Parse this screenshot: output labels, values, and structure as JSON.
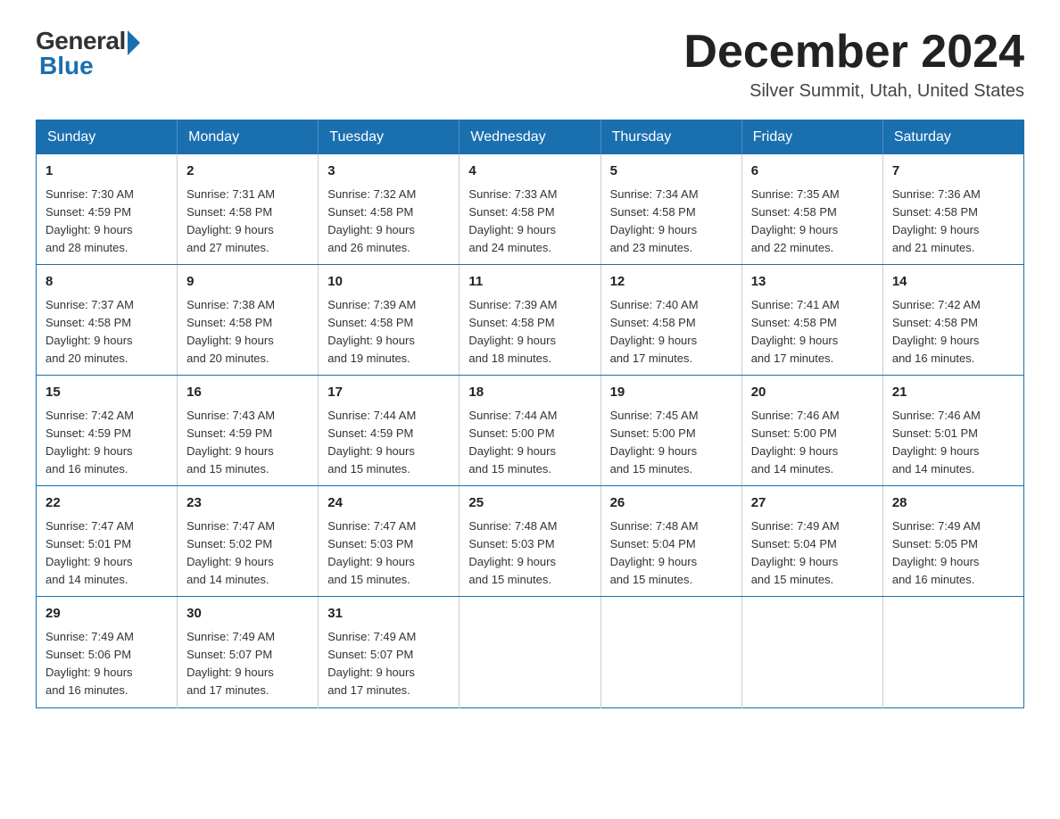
{
  "logo": {
    "general": "General",
    "blue": "Blue"
  },
  "title": {
    "month_year": "December 2024",
    "location": "Silver Summit, Utah, United States"
  },
  "days_of_week": [
    "Sunday",
    "Monday",
    "Tuesday",
    "Wednesday",
    "Thursday",
    "Friday",
    "Saturday"
  ],
  "weeks": [
    [
      {
        "day": "1",
        "sunrise": "7:30 AM",
        "sunset": "4:59 PM",
        "daylight": "9 hours and 28 minutes."
      },
      {
        "day": "2",
        "sunrise": "7:31 AM",
        "sunset": "4:58 PM",
        "daylight": "9 hours and 27 minutes."
      },
      {
        "day": "3",
        "sunrise": "7:32 AM",
        "sunset": "4:58 PM",
        "daylight": "9 hours and 26 minutes."
      },
      {
        "day": "4",
        "sunrise": "7:33 AM",
        "sunset": "4:58 PM",
        "daylight": "9 hours and 24 minutes."
      },
      {
        "day": "5",
        "sunrise": "7:34 AM",
        "sunset": "4:58 PM",
        "daylight": "9 hours and 23 minutes."
      },
      {
        "day": "6",
        "sunrise": "7:35 AM",
        "sunset": "4:58 PM",
        "daylight": "9 hours and 22 minutes."
      },
      {
        "day": "7",
        "sunrise": "7:36 AM",
        "sunset": "4:58 PM",
        "daylight": "9 hours and 21 minutes."
      }
    ],
    [
      {
        "day": "8",
        "sunrise": "7:37 AM",
        "sunset": "4:58 PM",
        "daylight": "9 hours and 20 minutes."
      },
      {
        "day": "9",
        "sunrise": "7:38 AM",
        "sunset": "4:58 PM",
        "daylight": "9 hours and 20 minutes."
      },
      {
        "day": "10",
        "sunrise": "7:39 AM",
        "sunset": "4:58 PM",
        "daylight": "9 hours and 19 minutes."
      },
      {
        "day": "11",
        "sunrise": "7:39 AM",
        "sunset": "4:58 PM",
        "daylight": "9 hours and 18 minutes."
      },
      {
        "day": "12",
        "sunrise": "7:40 AM",
        "sunset": "4:58 PM",
        "daylight": "9 hours and 17 minutes."
      },
      {
        "day": "13",
        "sunrise": "7:41 AM",
        "sunset": "4:58 PM",
        "daylight": "9 hours and 17 minutes."
      },
      {
        "day": "14",
        "sunrise": "7:42 AM",
        "sunset": "4:58 PM",
        "daylight": "9 hours and 16 minutes."
      }
    ],
    [
      {
        "day": "15",
        "sunrise": "7:42 AM",
        "sunset": "4:59 PM",
        "daylight": "9 hours and 16 minutes."
      },
      {
        "day": "16",
        "sunrise": "7:43 AM",
        "sunset": "4:59 PM",
        "daylight": "9 hours and 15 minutes."
      },
      {
        "day": "17",
        "sunrise": "7:44 AM",
        "sunset": "4:59 PM",
        "daylight": "9 hours and 15 minutes."
      },
      {
        "day": "18",
        "sunrise": "7:44 AM",
        "sunset": "5:00 PM",
        "daylight": "9 hours and 15 minutes."
      },
      {
        "day": "19",
        "sunrise": "7:45 AM",
        "sunset": "5:00 PM",
        "daylight": "9 hours and 15 minutes."
      },
      {
        "day": "20",
        "sunrise": "7:46 AM",
        "sunset": "5:00 PM",
        "daylight": "9 hours and 14 minutes."
      },
      {
        "day": "21",
        "sunrise": "7:46 AM",
        "sunset": "5:01 PM",
        "daylight": "9 hours and 14 minutes."
      }
    ],
    [
      {
        "day": "22",
        "sunrise": "7:47 AM",
        "sunset": "5:01 PM",
        "daylight": "9 hours and 14 minutes."
      },
      {
        "day": "23",
        "sunrise": "7:47 AM",
        "sunset": "5:02 PM",
        "daylight": "9 hours and 14 minutes."
      },
      {
        "day": "24",
        "sunrise": "7:47 AM",
        "sunset": "5:03 PM",
        "daylight": "9 hours and 15 minutes."
      },
      {
        "day": "25",
        "sunrise": "7:48 AM",
        "sunset": "5:03 PM",
        "daylight": "9 hours and 15 minutes."
      },
      {
        "day": "26",
        "sunrise": "7:48 AM",
        "sunset": "5:04 PM",
        "daylight": "9 hours and 15 minutes."
      },
      {
        "day": "27",
        "sunrise": "7:49 AM",
        "sunset": "5:04 PM",
        "daylight": "9 hours and 15 minutes."
      },
      {
        "day": "28",
        "sunrise": "7:49 AM",
        "sunset": "5:05 PM",
        "daylight": "9 hours and 16 minutes."
      }
    ],
    [
      {
        "day": "29",
        "sunrise": "7:49 AM",
        "sunset": "5:06 PM",
        "daylight": "9 hours and 16 minutes."
      },
      {
        "day": "30",
        "sunrise": "7:49 AM",
        "sunset": "5:07 PM",
        "daylight": "9 hours and 17 minutes."
      },
      {
        "day": "31",
        "sunrise": "7:49 AM",
        "sunset": "5:07 PM",
        "daylight": "9 hours and 17 minutes."
      },
      null,
      null,
      null,
      null
    ]
  ],
  "labels": {
    "sunrise": "Sunrise: ",
    "sunset": "Sunset: ",
    "daylight": "Daylight: "
  }
}
